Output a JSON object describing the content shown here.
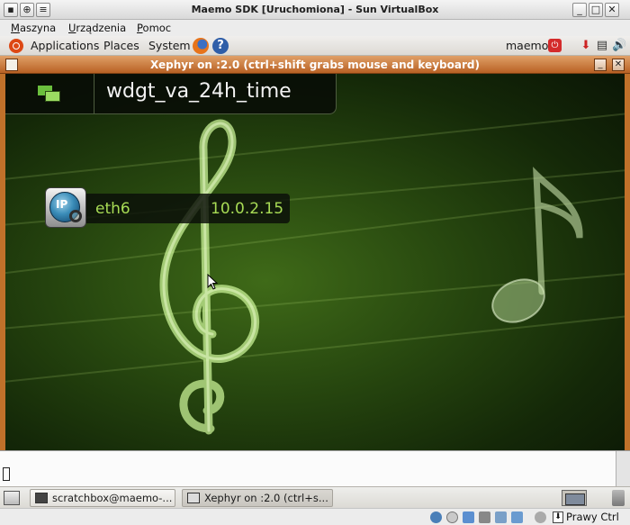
{
  "vbox": {
    "title": "Maemo SDK [Uruchomiona] - Sun VirtualBox",
    "menu": {
      "machine": "Maszyna",
      "devices": "Urządzenia",
      "help": "Pomoc"
    },
    "status": {
      "host_key": "Prawy Ctrl"
    }
  },
  "gnome_top": {
    "applications": "Applications",
    "places": "Places",
    "system": "System",
    "user": "maemo"
  },
  "xephyr": {
    "title": "Xephyr on :2.0 (ctrl+shift grabs mouse and keyboard)"
  },
  "maemo": {
    "app_title": "wdgt_va_24h_time",
    "network": {
      "interface": "eth6",
      "ip_address": "10.0.2.15",
      "icon_text": "IP"
    }
  },
  "taskbar": {
    "items": [
      {
        "label": "scratchbox@maemo-...",
        "active": false
      },
      {
        "label": "Xephyr on :2.0 (ctrl+s...",
        "active": true
      }
    ]
  },
  "colors": {
    "accent_orange": "#c0712a",
    "maemo_green": "#a8dc55",
    "desktop_dark": "#142808"
  },
  "icons": [
    "ubuntu-logo-icon",
    "firefox-icon",
    "help-icon",
    "power-icon",
    "network-tray-icon",
    "volume-icon",
    "terminal-icon",
    "treble-clef-icon",
    "music-note-icon",
    "mouse-cursor-icon"
  ]
}
